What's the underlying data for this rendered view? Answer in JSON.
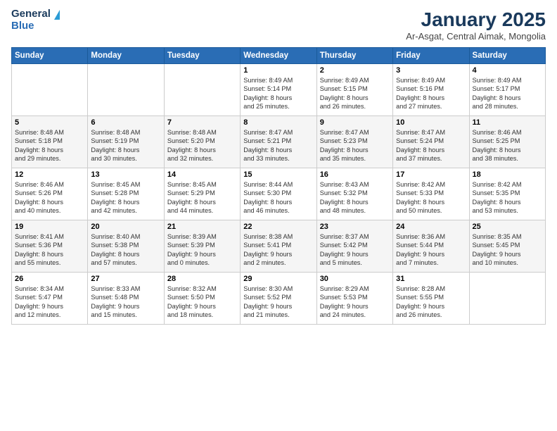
{
  "logo": {
    "line1": "General",
    "line2": "Blue"
  },
  "title": "January 2025",
  "subtitle": "Ar-Asgat, Central Aimak, Mongolia",
  "days_header": [
    "Sunday",
    "Monday",
    "Tuesday",
    "Wednesday",
    "Thursday",
    "Friday",
    "Saturday"
  ],
  "weeks": [
    [
      {
        "day": "",
        "text": ""
      },
      {
        "day": "",
        "text": ""
      },
      {
        "day": "",
        "text": ""
      },
      {
        "day": "1",
        "text": "Sunrise: 8:49 AM\nSunset: 5:14 PM\nDaylight: 8 hours\nand 25 minutes."
      },
      {
        "day": "2",
        "text": "Sunrise: 8:49 AM\nSunset: 5:15 PM\nDaylight: 8 hours\nand 26 minutes."
      },
      {
        "day": "3",
        "text": "Sunrise: 8:49 AM\nSunset: 5:16 PM\nDaylight: 8 hours\nand 27 minutes."
      },
      {
        "day": "4",
        "text": "Sunrise: 8:49 AM\nSunset: 5:17 PM\nDaylight: 8 hours\nand 28 minutes."
      }
    ],
    [
      {
        "day": "5",
        "text": "Sunrise: 8:48 AM\nSunset: 5:18 PM\nDaylight: 8 hours\nand 29 minutes."
      },
      {
        "day": "6",
        "text": "Sunrise: 8:48 AM\nSunset: 5:19 PM\nDaylight: 8 hours\nand 30 minutes."
      },
      {
        "day": "7",
        "text": "Sunrise: 8:48 AM\nSunset: 5:20 PM\nDaylight: 8 hours\nand 32 minutes."
      },
      {
        "day": "8",
        "text": "Sunrise: 8:47 AM\nSunset: 5:21 PM\nDaylight: 8 hours\nand 33 minutes."
      },
      {
        "day": "9",
        "text": "Sunrise: 8:47 AM\nSunset: 5:23 PM\nDaylight: 8 hours\nand 35 minutes."
      },
      {
        "day": "10",
        "text": "Sunrise: 8:47 AM\nSunset: 5:24 PM\nDaylight: 8 hours\nand 37 minutes."
      },
      {
        "day": "11",
        "text": "Sunrise: 8:46 AM\nSunset: 5:25 PM\nDaylight: 8 hours\nand 38 minutes."
      }
    ],
    [
      {
        "day": "12",
        "text": "Sunrise: 8:46 AM\nSunset: 5:26 PM\nDaylight: 8 hours\nand 40 minutes."
      },
      {
        "day": "13",
        "text": "Sunrise: 8:45 AM\nSunset: 5:28 PM\nDaylight: 8 hours\nand 42 minutes."
      },
      {
        "day": "14",
        "text": "Sunrise: 8:45 AM\nSunset: 5:29 PM\nDaylight: 8 hours\nand 44 minutes."
      },
      {
        "day": "15",
        "text": "Sunrise: 8:44 AM\nSunset: 5:30 PM\nDaylight: 8 hours\nand 46 minutes."
      },
      {
        "day": "16",
        "text": "Sunrise: 8:43 AM\nSunset: 5:32 PM\nDaylight: 8 hours\nand 48 minutes."
      },
      {
        "day": "17",
        "text": "Sunrise: 8:42 AM\nSunset: 5:33 PM\nDaylight: 8 hours\nand 50 minutes."
      },
      {
        "day": "18",
        "text": "Sunrise: 8:42 AM\nSunset: 5:35 PM\nDaylight: 8 hours\nand 53 minutes."
      }
    ],
    [
      {
        "day": "19",
        "text": "Sunrise: 8:41 AM\nSunset: 5:36 PM\nDaylight: 8 hours\nand 55 minutes."
      },
      {
        "day": "20",
        "text": "Sunrise: 8:40 AM\nSunset: 5:38 PM\nDaylight: 8 hours\nand 57 minutes."
      },
      {
        "day": "21",
        "text": "Sunrise: 8:39 AM\nSunset: 5:39 PM\nDaylight: 9 hours\nand 0 minutes."
      },
      {
        "day": "22",
        "text": "Sunrise: 8:38 AM\nSunset: 5:41 PM\nDaylight: 9 hours\nand 2 minutes."
      },
      {
        "day": "23",
        "text": "Sunrise: 8:37 AM\nSunset: 5:42 PM\nDaylight: 9 hours\nand 5 minutes."
      },
      {
        "day": "24",
        "text": "Sunrise: 8:36 AM\nSunset: 5:44 PM\nDaylight: 9 hours\nand 7 minutes."
      },
      {
        "day": "25",
        "text": "Sunrise: 8:35 AM\nSunset: 5:45 PM\nDaylight: 9 hours\nand 10 minutes."
      }
    ],
    [
      {
        "day": "26",
        "text": "Sunrise: 8:34 AM\nSunset: 5:47 PM\nDaylight: 9 hours\nand 12 minutes."
      },
      {
        "day": "27",
        "text": "Sunrise: 8:33 AM\nSunset: 5:48 PM\nDaylight: 9 hours\nand 15 minutes."
      },
      {
        "day": "28",
        "text": "Sunrise: 8:32 AM\nSunset: 5:50 PM\nDaylight: 9 hours\nand 18 minutes."
      },
      {
        "day": "29",
        "text": "Sunrise: 8:30 AM\nSunset: 5:52 PM\nDaylight: 9 hours\nand 21 minutes."
      },
      {
        "day": "30",
        "text": "Sunrise: 8:29 AM\nSunset: 5:53 PM\nDaylight: 9 hours\nand 24 minutes."
      },
      {
        "day": "31",
        "text": "Sunrise: 8:28 AM\nSunset: 5:55 PM\nDaylight: 9 hours\nand 26 minutes."
      },
      {
        "day": "",
        "text": ""
      }
    ]
  ]
}
